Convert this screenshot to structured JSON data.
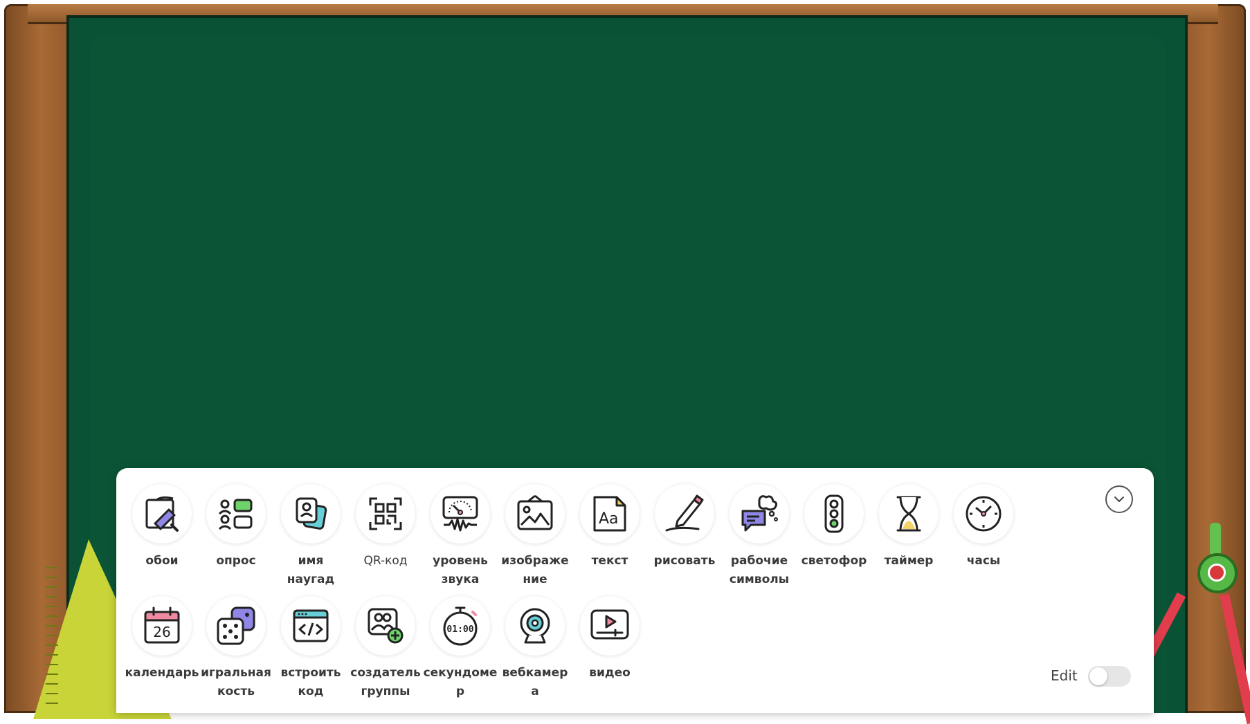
{
  "toolbar": {
    "row1": [
      {
        "id": "wallpaper",
        "label": "обои",
        "icon": "wallpaper-roller-icon"
      },
      {
        "id": "poll",
        "label": "опрос",
        "icon": "poll-icon"
      },
      {
        "id": "random-name",
        "label": "имя\nнаугад",
        "icon": "random-name-icon"
      },
      {
        "id": "qr-code",
        "label": "QR-код",
        "icon": "qr-code-icon"
      },
      {
        "id": "sound-level",
        "label": "уровень\nзвука",
        "icon": "sound-meter-icon"
      },
      {
        "id": "image",
        "label": "изображе\nние",
        "icon": "image-icon"
      },
      {
        "id": "text",
        "label": "текст",
        "icon": "text-icon"
      },
      {
        "id": "draw",
        "label": "рисовать",
        "icon": "pencil-icon"
      },
      {
        "id": "work-symbols",
        "label": "рабочие\nсимволы",
        "icon": "chat-bubble-icon"
      },
      {
        "id": "traffic-light",
        "label": "светофор",
        "icon": "traffic-light-icon"
      },
      {
        "id": "timer",
        "label": "таймер",
        "icon": "hourglass-icon"
      },
      {
        "id": "clock",
        "label": "часы",
        "icon": "clock-icon"
      }
    ],
    "row2": [
      {
        "id": "calendar",
        "label": "календарь",
        "icon": "calendar-icon",
        "day": "26"
      },
      {
        "id": "dice",
        "label": "игральная\nкость",
        "icon": "dice-icon"
      },
      {
        "id": "embed-code",
        "label": "встроить\nкод",
        "icon": "code-icon"
      },
      {
        "id": "group-maker",
        "label": "создатель\nгруппы",
        "icon": "group-add-icon"
      },
      {
        "id": "stopwatch",
        "label": "секундоме\nр",
        "icon": "stopwatch-icon",
        "display": "01:00"
      },
      {
        "id": "webcam",
        "label": "вебкамер\nа",
        "icon": "webcam-icon"
      },
      {
        "id": "video",
        "label": "видео",
        "icon": "video-icon"
      }
    ],
    "edit_label": "Edit",
    "edit_enabled": false
  },
  "colors": {
    "board_green": "#0a5236",
    "frame_brown": "#a0622f",
    "accent_purple": "#8f86e6",
    "accent_green": "#6dd36a",
    "accent_teal": "#66cfd8",
    "accent_pink": "#f08aa0",
    "accent_yellow": "#f4d36b"
  }
}
